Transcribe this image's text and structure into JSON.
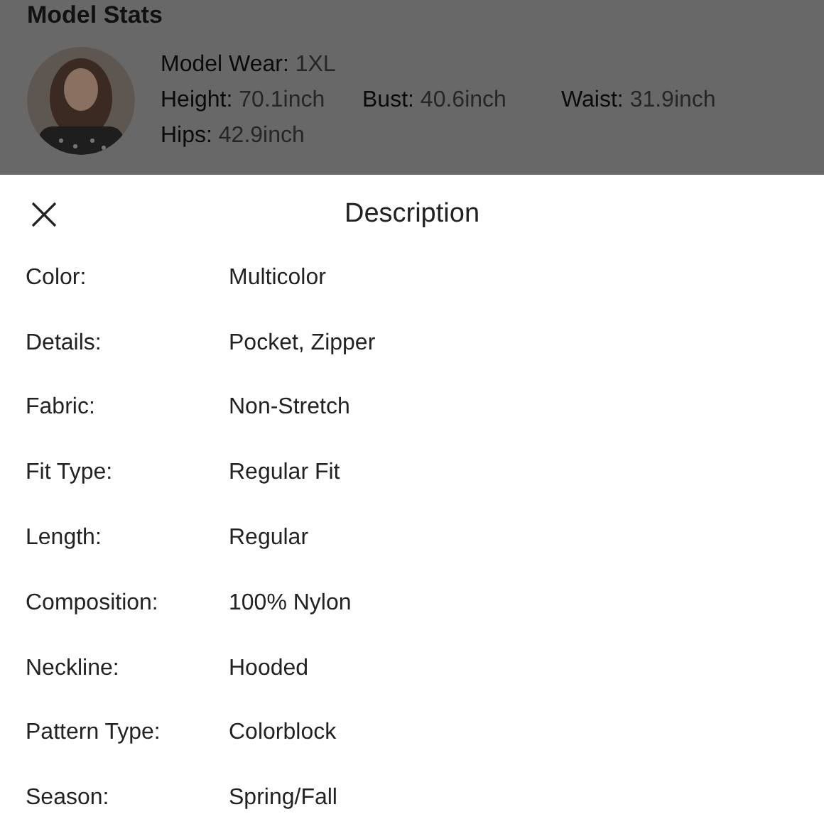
{
  "model_stats": {
    "title": "Model Stats",
    "lines": [
      [
        {
          "label": "Model Wear:",
          "value": "1XL"
        }
      ],
      [
        {
          "label": "Height:",
          "value": "70.1inch"
        },
        {
          "label": "Bust:",
          "value": "40.6inch"
        },
        {
          "label": "Waist:",
          "value": "31.9inch"
        }
      ],
      [
        {
          "label": "Hips:",
          "value": "42.9inch"
        }
      ]
    ]
  },
  "sheet": {
    "title": "Description",
    "rows": [
      {
        "label": "Color:",
        "value": "Multicolor"
      },
      {
        "label": "Details:",
        "value": "Pocket, Zipper"
      },
      {
        "label": "Fabric:",
        "value": "Non-Stretch"
      },
      {
        "label": "Fit Type:",
        "value": "Regular Fit"
      },
      {
        "label": "Length:",
        "value": "Regular"
      },
      {
        "label": "Composition:",
        "value": "100% Nylon"
      },
      {
        "label": "Neckline:",
        "value": "Hooded"
      },
      {
        "label": "Pattern Type:",
        "value": "Colorblock"
      },
      {
        "label": "Season:",
        "value": "Spring/Fall"
      }
    ]
  }
}
